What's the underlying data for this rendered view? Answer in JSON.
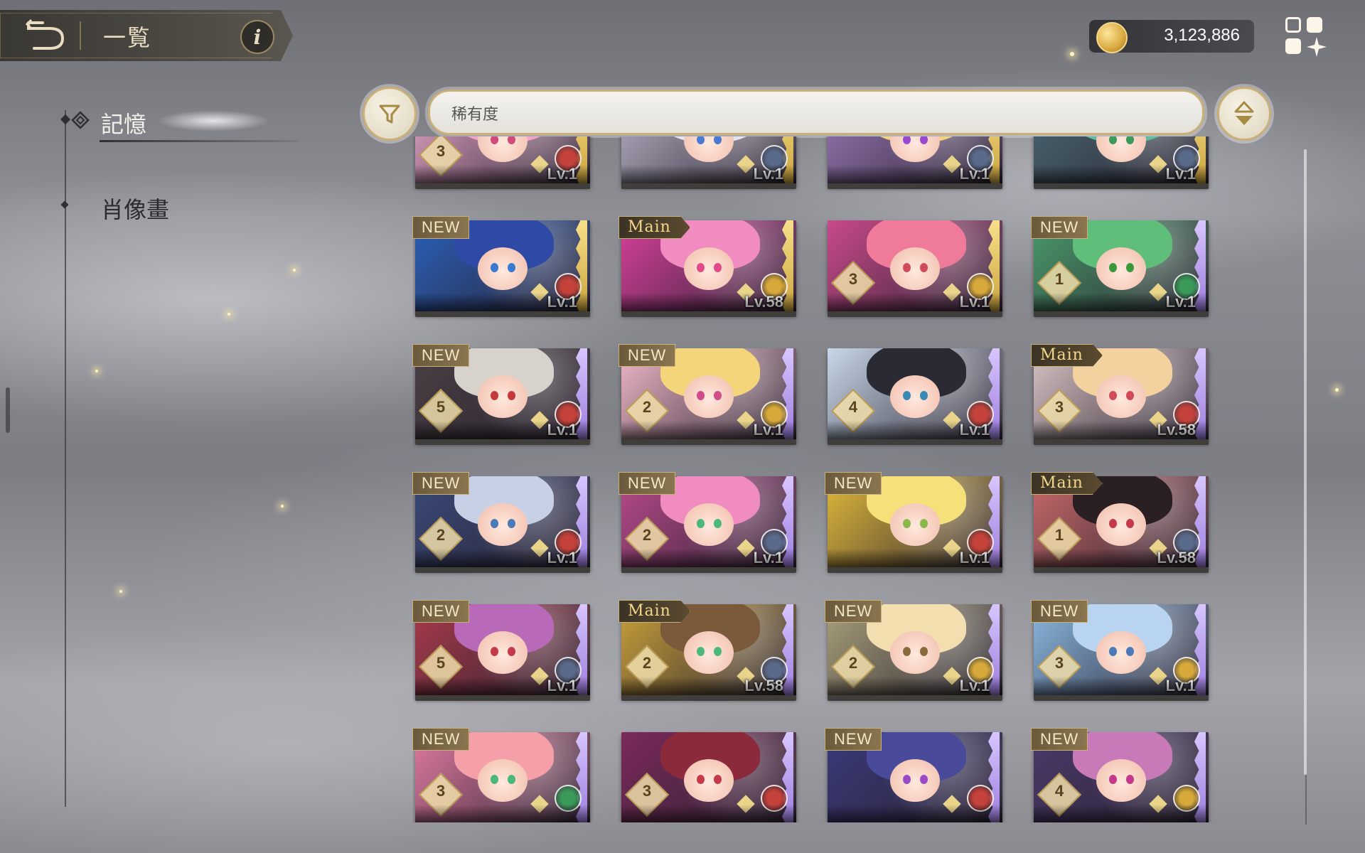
{
  "header": {
    "title": "一覧",
    "info_label": "i"
  },
  "currency": {
    "value": "3,123,886"
  },
  "nav": {
    "items": [
      {
        "label": "記憶",
        "active": true
      },
      {
        "label": "肖像畫",
        "active": false
      }
    ]
  },
  "filter": {
    "sort_label": "稀有度"
  },
  "colors": {
    "accent": "#c9b078",
    "attributes": {
      "fire": "#c4423a",
      "water": "#3a6fc4",
      "wood": "#3a9a5a",
      "light": "#d6a93a",
      "dark": "#8a4ac4",
      "void": "#5a6a8a"
    }
  },
  "cards": [
    {
      "badge": "",
      "rank": "3",
      "level": "Lv.1",
      "edge": "gold",
      "attribute": "fire",
      "hair": "#f4a3c6",
      "eyes": "#d14a7a",
      "bg": "#e8a6c9"
    },
    {
      "badge": "",
      "rank": "",
      "level": "Lv.1",
      "edge": "gold",
      "attribute": "void",
      "hair": "#e4e2ec",
      "eyes": "#4a7ad1",
      "bg": "#b9b4c6"
    },
    {
      "badge": "",
      "rank": "",
      "level": "Lv.1",
      "edge": "gold",
      "attribute": "void",
      "hair": "#f3d27a",
      "eyes": "#9a4ad1",
      "bg": "#9a7ab8"
    },
    {
      "badge": "",
      "rank": "",
      "level": "Lv.1",
      "edge": "gold",
      "attribute": "void",
      "hair": "#5fbf9a",
      "eyes": "#3a9a5a",
      "bg": "#4a6a74"
    },
    {
      "badge": "NEW",
      "rank": "",
      "level": "Lv.1",
      "edge": "gold",
      "attribute": "fire",
      "hair": "#2e4aa6",
      "eyes": "#3a7ad1",
      "bg": "#2a5fb8"
    },
    {
      "badge": "Main",
      "rank": "",
      "level": "Lv.58",
      "edge": "gold",
      "attribute": "light",
      "hair": "#f08cc0",
      "eyes": "#e04a8a",
      "bg": "#d6409a"
    },
    {
      "badge": "",
      "rank": "3",
      "level": "Lv.1",
      "edge": "gold",
      "attribute": "light",
      "hair": "#f07a9a",
      "eyes": "#d14a5a",
      "bg": "#c84a8a"
    },
    {
      "badge": "NEW",
      "rank": "1",
      "level": "Lv.1",
      "edge": "purple",
      "attribute": "wood",
      "hair": "#5fbf7a",
      "eyes": "#3a9a3a",
      "bg": "#4a9a6a"
    },
    {
      "badge": "NEW",
      "rank": "5",
      "level": "Lv.1",
      "edge": "purple",
      "attribute": "fire",
      "hair": "#d8d2cc",
      "eyes": "#c43a3a",
      "bg": "#4a4044"
    },
    {
      "badge": "NEW",
      "rank": "2",
      "level": "Lv.1",
      "edge": "purple",
      "attribute": "light",
      "hair": "#f5d57a",
      "eyes": "#d14a8a",
      "bg": "#f0b8c8"
    },
    {
      "badge": "",
      "rank": "4",
      "level": "Lv.1",
      "edge": "purple",
      "attribute": "fire",
      "hair": "#2a2a34",
      "eyes": "#3a8ab8",
      "bg": "#c8d8e8"
    },
    {
      "badge": "Main",
      "rank": "3",
      "level": "Lv.58",
      "edge": "purple",
      "attribute": "fire",
      "hair": "#f3d2a0",
      "eyes": "#d14a5a",
      "bg": "#d8c4c4"
    },
    {
      "badge": "NEW",
      "rank": "2",
      "level": "Lv.1",
      "edge": "purple",
      "attribute": "fire",
      "hair": "#c8d0e6",
      "eyes": "#4a7ab8",
      "bg": "#3a4a7a"
    },
    {
      "badge": "NEW",
      "rank": "2",
      "level": "Lv.1",
      "edge": "purple",
      "attribute": "void",
      "hair": "#f08cc0",
      "eyes": "#4ab87a",
      "bg": "#b84a8a"
    },
    {
      "badge": "NEW",
      "rank": "",
      "level": "Lv.1",
      "edge": "purple",
      "attribute": "fire",
      "hair": "#f5e07a",
      "eyes": "#8ab84a",
      "bg": "#e0b83a"
    },
    {
      "badge": "Main",
      "rank": "1",
      "level": "Lv.58",
      "edge": "purple",
      "attribute": "void",
      "hair": "#2a2024",
      "eyes": "#c43a4a",
      "bg": "#c86a6a"
    },
    {
      "badge": "NEW",
      "rank": "5",
      "level": "Lv.1",
      "edge": "purple",
      "attribute": "void",
      "hair": "#b86ab8",
      "eyes": "#c43a4a",
      "bg": "#a83a4a"
    },
    {
      "badge": "Main",
      "rank": "2",
      "level": "Lv.58",
      "edge": "purple",
      "attribute": "void",
      "hair": "#7a5a3a",
      "eyes": "#4ab87a",
      "bg": "#c8a03a"
    },
    {
      "badge": "NEW",
      "rank": "2",
      "level": "Lv.1",
      "edge": "purple",
      "attribute": "light",
      "hair": "#f3deb0",
      "eyes": "#8a6a3a",
      "bg": "#a8a07a"
    },
    {
      "badge": "NEW",
      "rank": "3",
      "level": "Lv.1",
      "edge": "purple",
      "attribute": "light",
      "hair": "#b8d4f0",
      "eyes": "#4a7ab8",
      "bg": "#8ab8e0"
    },
    {
      "badge": "NEW",
      "rank": "3",
      "level": "",
      "edge": "purple",
      "attribute": "wood",
      "hair": "#f5a0a8",
      "eyes": "#4ab87a",
      "bg": "#e07aa0"
    },
    {
      "badge": "",
      "rank": "3",
      "level": "",
      "edge": "purple",
      "attribute": "fire",
      "hair": "#8a2a3a",
      "eyes": "#c43a4a",
      "bg": "#7a2a5a"
    },
    {
      "badge": "NEW",
      "rank": "",
      "level": "",
      "edge": "purple",
      "attribute": "fire",
      "hair": "#4a4a9a",
      "eyes": "#9a4ac4",
      "bg": "#3a3a7a"
    },
    {
      "badge": "NEW",
      "rank": "4",
      "level": "",
      "edge": "purple",
      "attribute": "light",
      "hair": "#c87ab8",
      "eyes": "#c43a8a",
      "bg": "#4a3a6a"
    }
  ]
}
